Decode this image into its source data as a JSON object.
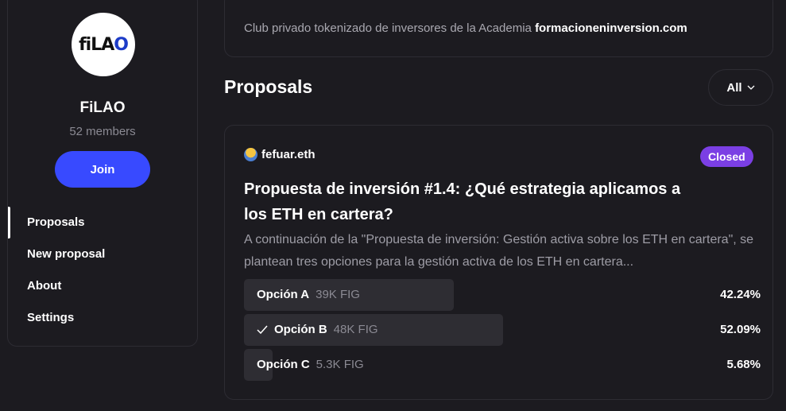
{
  "space": {
    "logo_text": "fiLAO",
    "name": "FiLAO",
    "members": "52 members",
    "join_label": "Join"
  },
  "nav": [
    {
      "label": "Proposals",
      "active": true
    },
    {
      "label": "New proposal"
    },
    {
      "label": "About"
    },
    {
      "label": "Settings"
    }
  ],
  "about": {
    "text": "Club privado tokenizado de inversores de la Academia",
    "link": "formacioneninversion.com"
  },
  "proposals_header": {
    "title": "Proposals",
    "filter_label": "All"
  },
  "proposal": {
    "author": "fefuar.eth",
    "status": "Closed",
    "status_color": "#7b3fe4",
    "title": "Propuesta de inversión #1.4: ¿Qué estrategia aplicamos a los ETH en cartera?",
    "body": "A continuación de la \"Propuesta de inversión: Gestión activa sobre los ETH en cartera\", se plantean tres opciones para la gestión activa de los ETH en cartera...",
    "choices": [
      {
        "label": "Opción A",
        "score": "39K FIG",
        "percent": "42.24%",
        "fraction": 0.4224,
        "winner": false
      },
      {
        "label": "Opción B",
        "score": "48K FIG",
        "percent": "52.09%",
        "fraction": 0.5209,
        "winner": true
      },
      {
        "label": "Opción C",
        "score": "5.3K FIG",
        "percent": "5.68%",
        "fraction": 0.0568,
        "winner": false
      }
    ]
  },
  "colors": {
    "background": "#1c1b20",
    "accent": "#384aff",
    "border": "#2d2c33"
  }
}
